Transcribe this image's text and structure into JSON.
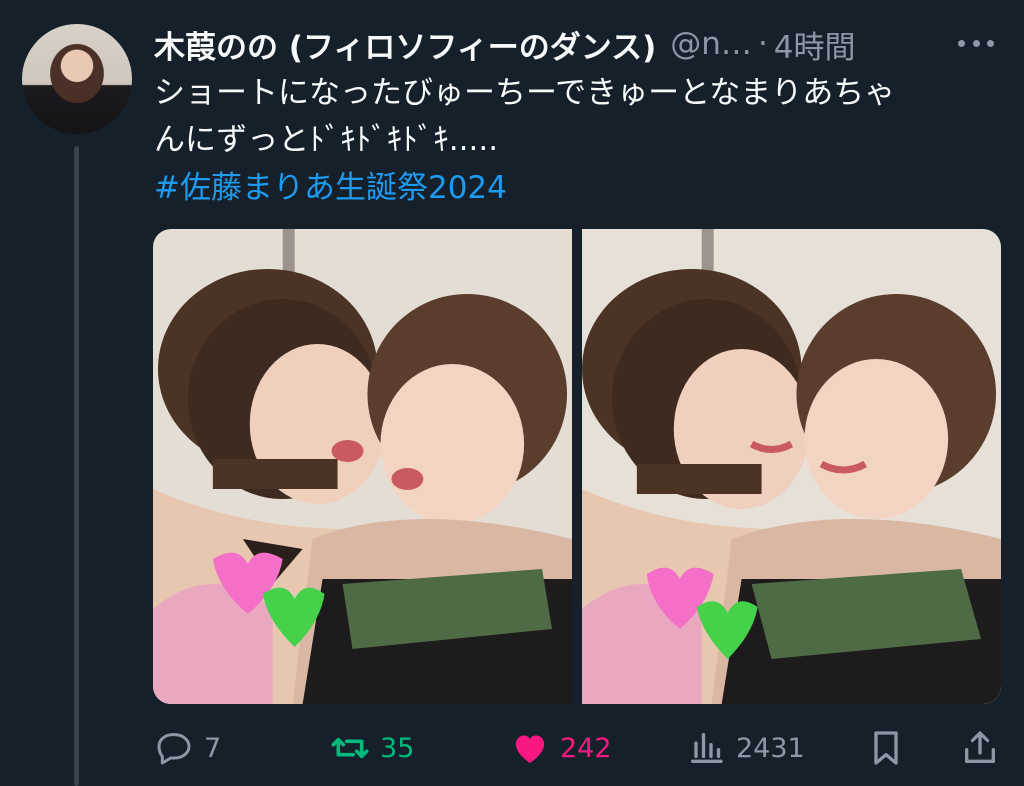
{
  "tweet": {
    "author_name": "木葭のの (フィロソフィーのダンス)",
    "author_handle": "@n…",
    "separator": "·",
    "time": "4時間",
    "body_line1": "ショートになったびゅーちーできゅーとなまりあちゃ",
    "body_line2": "んにずっとﾄﾞｷﾄﾞｷﾄﾞｷ.....",
    "hashtag": "#佐藤まりあ生誕祭2024"
  },
  "actions": {
    "reply_count": "7",
    "retweet_count": "35",
    "like_count": "242",
    "views_count": "2431"
  },
  "colors": {
    "background": "#15202b",
    "link": "#1d9bf0",
    "retweet": "#00ba7c",
    "like": "#f91880",
    "muted": "#8b98a5"
  },
  "icons": [
    "more-icon",
    "reply-icon",
    "retweet-icon",
    "like-icon",
    "views-icon",
    "bookmark-icon",
    "share-icon"
  ]
}
